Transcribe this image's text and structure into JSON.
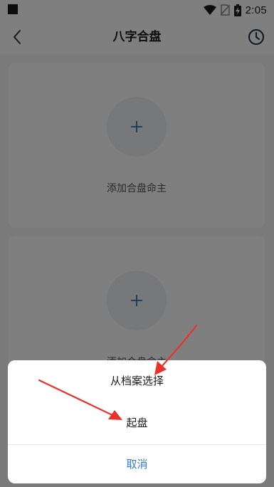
{
  "status_bar": {
    "time": "2:05",
    "icons": [
      "notification-square-icon",
      "wifi-icon",
      "no-sim-icon",
      "battery-charging-icon"
    ]
  },
  "header": {
    "title": "八字合盘",
    "back_icon": "chevron-left-icon",
    "history_icon": "clock-icon"
  },
  "cards": [
    {
      "label": "添加合盘命主",
      "icon": "plus-icon"
    },
    {
      "label": "添加合盘命主",
      "icon": "plus-icon"
    }
  ],
  "action_sheet": {
    "choose_from_archive": "从档案选择",
    "start_chart": "起盘",
    "cancel": "取消"
  },
  "colors": {
    "accent": "#2f7fd6",
    "annotation": "#e8322b",
    "overlay": "rgba(0,0,0,0.5)"
  }
}
